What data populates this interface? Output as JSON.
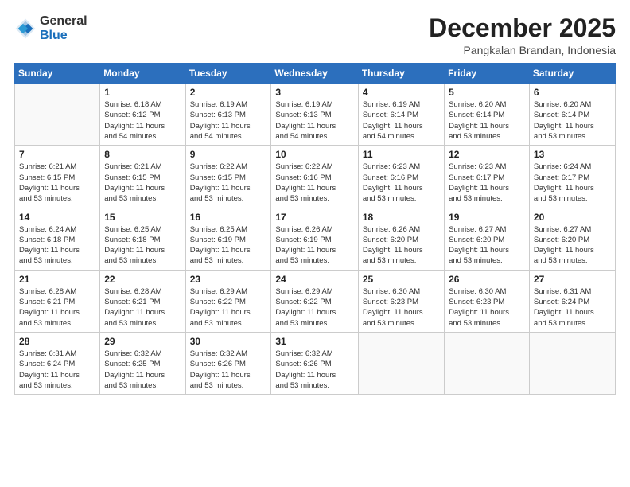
{
  "logo": {
    "general": "General",
    "blue": "Blue"
  },
  "title": {
    "month_year": "December 2025",
    "location": "Pangkalan Brandan, Indonesia"
  },
  "days_of_week": [
    "Sunday",
    "Monday",
    "Tuesday",
    "Wednesday",
    "Thursday",
    "Friday",
    "Saturday"
  ],
  "weeks": [
    [
      {
        "day": "",
        "info": ""
      },
      {
        "day": "1",
        "info": "Sunrise: 6:18 AM\nSunset: 6:12 PM\nDaylight: 11 hours\nand 54 minutes."
      },
      {
        "day": "2",
        "info": "Sunrise: 6:19 AM\nSunset: 6:13 PM\nDaylight: 11 hours\nand 54 minutes."
      },
      {
        "day": "3",
        "info": "Sunrise: 6:19 AM\nSunset: 6:13 PM\nDaylight: 11 hours\nand 54 minutes."
      },
      {
        "day": "4",
        "info": "Sunrise: 6:19 AM\nSunset: 6:14 PM\nDaylight: 11 hours\nand 54 minutes."
      },
      {
        "day": "5",
        "info": "Sunrise: 6:20 AM\nSunset: 6:14 PM\nDaylight: 11 hours\nand 53 minutes."
      },
      {
        "day": "6",
        "info": "Sunrise: 6:20 AM\nSunset: 6:14 PM\nDaylight: 11 hours\nand 53 minutes."
      }
    ],
    [
      {
        "day": "7",
        "info": "Sunrise: 6:21 AM\nSunset: 6:15 PM\nDaylight: 11 hours\nand 53 minutes."
      },
      {
        "day": "8",
        "info": "Sunrise: 6:21 AM\nSunset: 6:15 PM\nDaylight: 11 hours\nand 53 minutes."
      },
      {
        "day": "9",
        "info": "Sunrise: 6:22 AM\nSunset: 6:15 PM\nDaylight: 11 hours\nand 53 minutes."
      },
      {
        "day": "10",
        "info": "Sunrise: 6:22 AM\nSunset: 6:16 PM\nDaylight: 11 hours\nand 53 minutes."
      },
      {
        "day": "11",
        "info": "Sunrise: 6:23 AM\nSunset: 6:16 PM\nDaylight: 11 hours\nand 53 minutes."
      },
      {
        "day": "12",
        "info": "Sunrise: 6:23 AM\nSunset: 6:17 PM\nDaylight: 11 hours\nand 53 minutes."
      },
      {
        "day": "13",
        "info": "Sunrise: 6:24 AM\nSunset: 6:17 PM\nDaylight: 11 hours\nand 53 minutes."
      }
    ],
    [
      {
        "day": "14",
        "info": "Sunrise: 6:24 AM\nSunset: 6:18 PM\nDaylight: 11 hours\nand 53 minutes."
      },
      {
        "day": "15",
        "info": "Sunrise: 6:25 AM\nSunset: 6:18 PM\nDaylight: 11 hours\nand 53 minutes."
      },
      {
        "day": "16",
        "info": "Sunrise: 6:25 AM\nSunset: 6:19 PM\nDaylight: 11 hours\nand 53 minutes."
      },
      {
        "day": "17",
        "info": "Sunrise: 6:26 AM\nSunset: 6:19 PM\nDaylight: 11 hours\nand 53 minutes."
      },
      {
        "day": "18",
        "info": "Sunrise: 6:26 AM\nSunset: 6:20 PM\nDaylight: 11 hours\nand 53 minutes."
      },
      {
        "day": "19",
        "info": "Sunrise: 6:27 AM\nSunset: 6:20 PM\nDaylight: 11 hours\nand 53 minutes."
      },
      {
        "day": "20",
        "info": "Sunrise: 6:27 AM\nSunset: 6:20 PM\nDaylight: 11 hours\nand 53 minutes."
      }
    ],
    [
      {
        "day": "21",
        "info": "Sunrise: 6:28 AM\nSunset: 6:21 PM\nDaylight: 11 hours\nand 53 minutes."
      },
      {
        "day": "22",
        "info": "Sunrise: 6:28 AM\nSunset: 6:21 PM\nDaylight: 11 hours\nand 53 minutes."
      },
      {
        "day": "23",
        "info": "Sunrise: 6:29 AM\nSunset: 6:22 PM\nDaylight: 11 hours\nand 53 minutes."
      },
      {
        "day": "24",
        "info": "Sunrise: 6:29 AM\nSunset: 6:22 PM\nDaylight: 11 hours\nand 53 minutes."
      },
      {
        "day": "25",
        "info": "Sunrise: 6:30 AM\nSunset: 6:23 PM\nDaylight: 11 hours\nand 53 minutes."
      },
      {
        "day": "26",
        "info": "Sunrise: 6:30 AM\nSunset: 6:23 PM\nDaylight: 11 hours\nand 53 minutes."
      },
      {
        "day": "27",
        "info": "Sunrise: 6:31 AM\nSunset: 6:24 PM\nDaylight: 11 hours\nand 53 minutes."
      }
    ],
    [
      {
        "day": "28",
        "info": "Sunrise: 6:31 AM\nSunset: 6:24 PM\nDaylight: 11 hours\nand 53 minutes."
      },
      {
        "day": "29",
        "info": "Sunrise: 6:32 AM\nSunset: 6:25 PM\nDaylight: 11 hours\nand 53 minutes."
      },
      {
        "day": "30",
        "info": "Sunrise: 6:32 AM\nSunset: 6:26 PM\nDaylight: 11 hours\nand 53 minutes."
      },
      {
        "day": "31",
        "info": "Sunrise: 6:32 AM\nSunset: 6:26 PM\nDaylight: 11 hours\nand 53 minutes."
      },
      {
        "day": "",
        "info": ""
      },
      {
        "day": "",
        "info": ""
      },
      {
        "day": "",
        "info": ""
      }
    ]
  ]
}
